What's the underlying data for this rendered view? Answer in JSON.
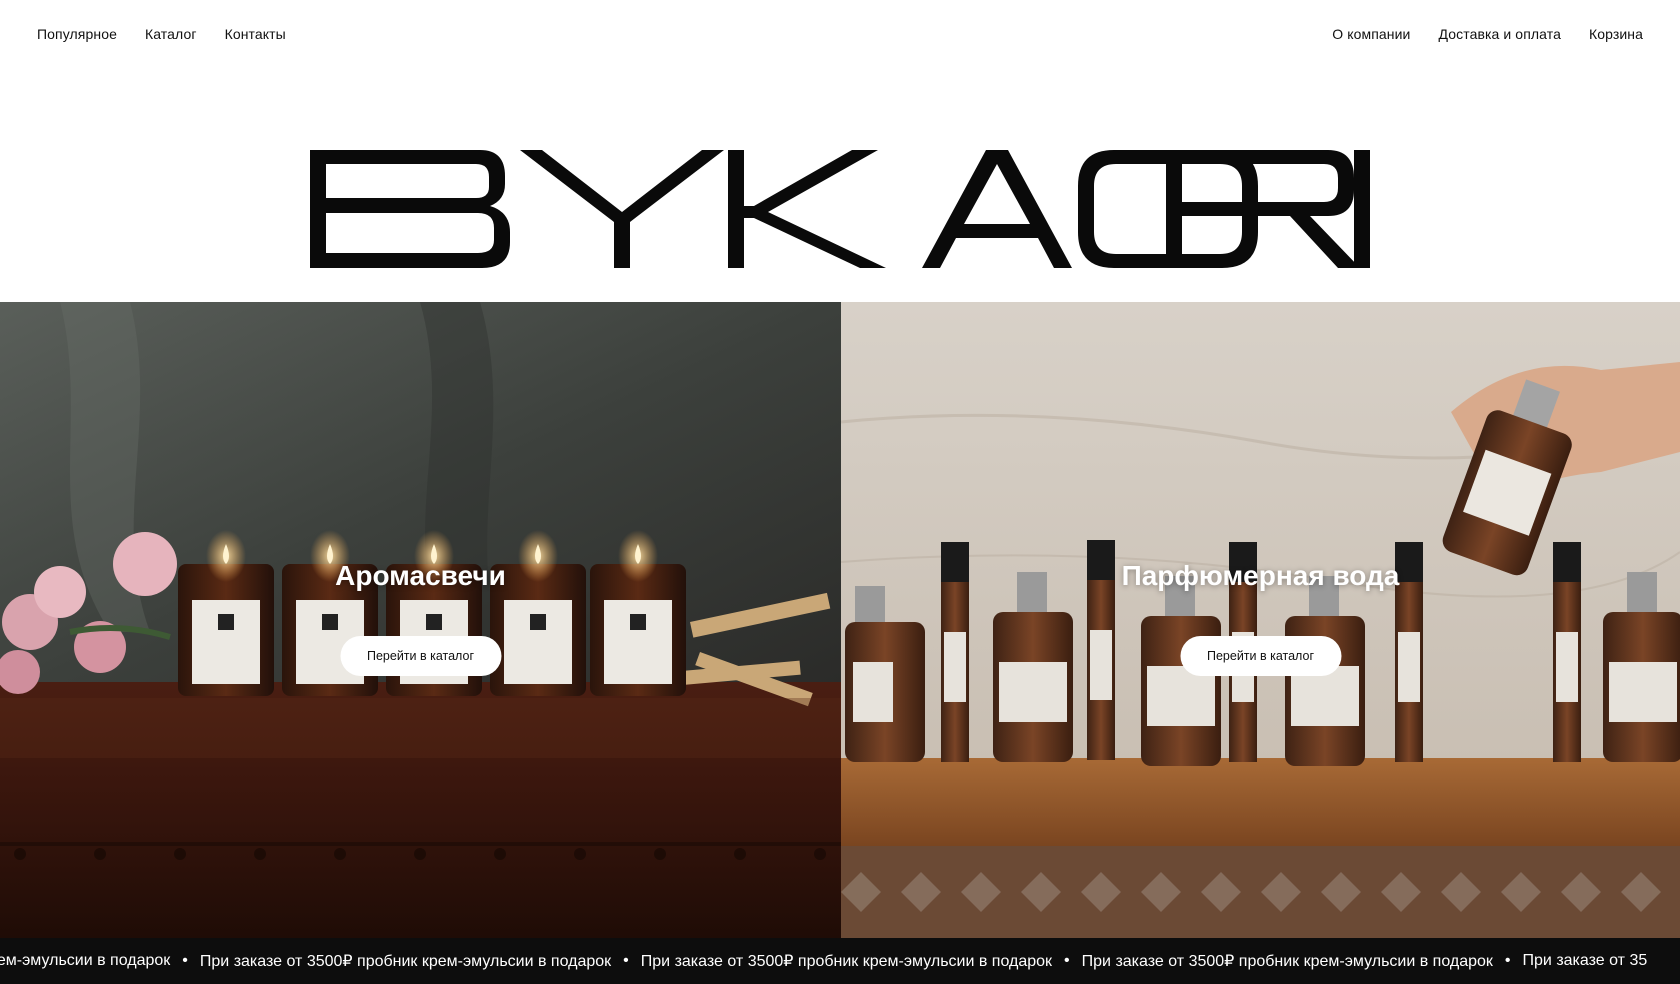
{
  "nav": {
    "left": [
      "Популярное",
      "Каталог",
      "Контакты"
    ],
    "right": [
      "О компании",
      "Доставка и оплата",
      "Корзина"
    ]
  },
  "brand": {
    "logo_text": "BY KAORI"
  },
  "panels": [
    {
      "title": "Аромасвечи",
      "button_label": "Перейти в каталог"
    },
    {
      "title": "Парфюмерная вода",
      "button_label": "Перейти в каталог"
    }
  ],
  "marquee": {
    "text_first": "рем-эмульсии в подарок",
    "text": "При заказе от 3500₽ пробник крем-эмульсии в подарок",
    "text_last": "При заказе от 35",
    "bullet": "•"
  },
  "icons": {
    "marquee_separator": "bullet-icon"
  },
  "colors": {
    "marquee_bg": "#0d0d0d",
    "button_bg": "#ffffff"
  }
}
